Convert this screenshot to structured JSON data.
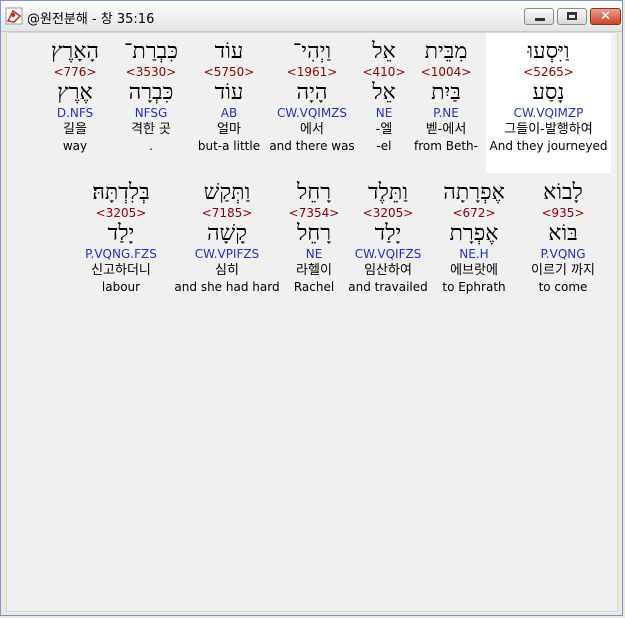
{
  "window": {
    "title": "@원전분해 - 창 35:16"
  },
  "row1": [
    {
      "heb": "וַיִּסְעוּ",
      "strong": "<5265>",
      "lemma": "נָסַע",
      "parse": "CW.VQIMZP",
      "kor": "그들이-발행하여",
      "eng": "And they journeyed"
    },
    {
      "heb": "מִבֵּית",
      "strong": "<1004>",
      "lemma": "בַּיִת",
      "parse": "P.NE",
      "kor": "벧-에서",
      "eng": "from Beth-"
    },
    {
      "heb": "אֵל",
      "strong": "<410>",
      "lemma": "אֵל",
      "parse": "NE",
      "kor": "-엘",
      "eng": "-el"
    },
    {
      "heb": "וַיְהִי־",
      "strong": "<1961>",
      "lemma": "הָיָה",
      "parse": "CW.VQIMZS",
      "kor": "에서",
      "eng": "and there was"
    },
    {
      "heb": "עוֹד",
      "strong": "<5750>",
      "lemma": "עוֹד",
      "parse": "AB",
      "kor": "얼마",
      "eng": "but-a little"
    },
    {
      "heb": "כִּבְרַת־",
      "strong": "<3530>",
      "lemma": "כִּבְרָה",
      "parse": "NFSG",
      "kor": "격한 곳",
      "eng": "."
    },
    {
      "heb": "הָאָרֶץ",
      "strong": "<776>",
      "lemma": "אֶרֶץ",
      "parse": "D.NFS",
      "kor": "길을",
      "eng": "way"
    }
  ],
  "row2": [
    {
      "heb": "לָבוֹא",
      "strong": "<935>",
      "lemma": "בּוֹא",
      "parse": "P.VQNG",
      "kor": "이르기 까지",
      "eng": "to come"
    },
    {
      "heb": "אֶפְרָתָה",
      "strong": "<672>",
      "lemma": "אֶפְרָת",
      "parse": "NE.H",
      "kor": "에브랏에",
      "eng": "to Ephrath"
    },
    {
      "heb": "וַתֵּלֶד",
      "strong": "<3205>",
      "lemma": "יָלַד",
      "parse": "CW.VQIFZS",
      "kor": "임산하여",
      "eng": "and travailed"
    },
    {
      "heb": "רָחֵל",
      "strong": "<7354>",
      "lemma": "רָחֵל",
      "parse": "NE",
      "kor": "라헬이",
      "eng": "Rachel"
    },
    {
      "heb": "וַתְּקַשׁ",
      "strong": "<7185>",
      "lemma": "קָשָׁה",
      "parse": "CW.VPIFZS",
      "kor": "심히",
      "eng": "and she had hard"
    },
    {
      "heb": "בְּלִדְתָּהּ׃",
      "strong": "<3205>",
      "lemma": "יָלַד",
      "parse": "P.VQNG.FZS",
      "kor": "신고하더니",
      "eng": "labour"
    }
  ]
}
